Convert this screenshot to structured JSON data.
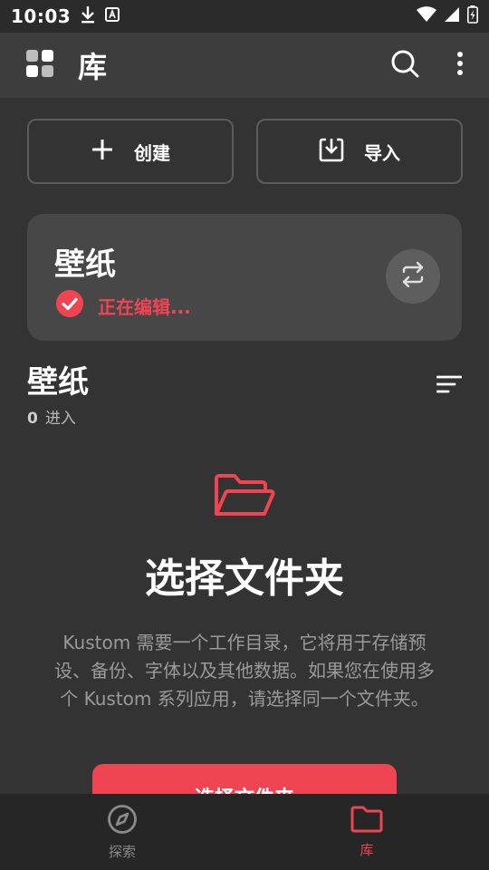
{
  "status_bar": {
    "time": "10:03"
  },
  "app_bar": {
    "title": "库",
    "icons": {
      "logo": "dashboard-icon",
      "search": "search-icon",
      "more": "more-vert-icon"
    }
  },
  "actions": {
    "create_label": "创建",
    "import_label": "导入"
  },
  "project_card": {
    "title": "壁纸",
    "status": "正在编辑..."
  },
  "section": {
    "title": "壁纸",
    "count": "0",
    "count_label": "进入"
  },
  "empty_state": {
    "title": "选择文件夹",
    "description": "Kustom 需要一个工作目录，它将用于存储预设、备份、字体以及其他数据。如果您在使用多个 Kustom 系列应用，请选择同一个文件夹。",
    "button_label": "选择文件夹"
  },
  "bottom_nav": {
    "items": [
      {
        "label": "探索",
        "icon": "compass-icon",
        "active": false
      },
      {
        "label": "库",
        "icon": "folder-icon",
        "active": true
      }
    ]
  },
  "colors": {
    "accent": "#ef4452",
    "background": "#333333",
    "appbar": "#3d3d3d",
    "card": "#474747",
    "nav": "#262626"
  }
}
